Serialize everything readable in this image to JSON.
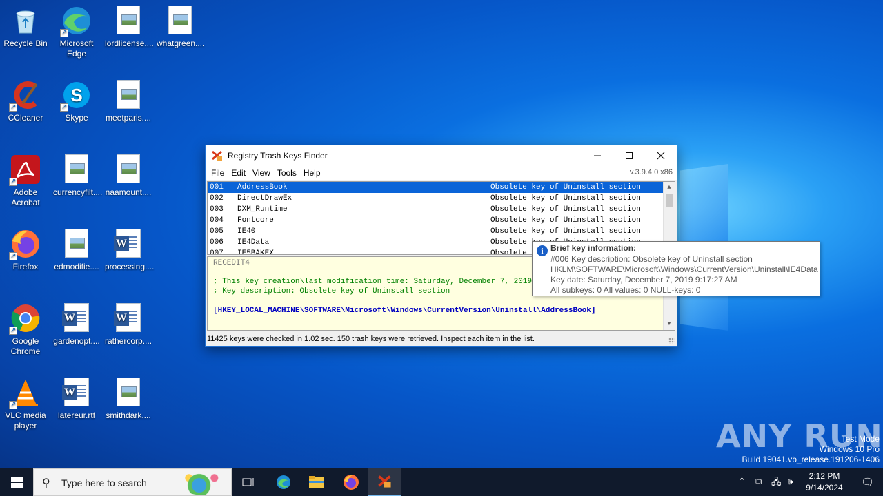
{
  "desktop": {
    "icons": [
      {
        "label": "Recycle Bin",
        "type": "recycle"
      },
      {
        "label": "Microsoft Edge",
        "type": "edge"
      },
      {
        "label": "lordlicense....",
        "type": "file"
      },
      {
        "label": "whatgreen....",
        "type": "file"
      },
      {
        "label": "CCleaner",
        "type": "ccleaner"
      },
      {
        "label": "Skype",
        "type": "skype"
      },
      {
        "label": "meetparis....",
        "type": "file"
      },
      {
        "label": "Adobe Acrobat",
        "type": "acrobat"
      },
      {
        "label": "currencyfilt....",
        "type": "file"
      },
      {
        "label": "naamount....",
        "type": "file"
      },
      {
        "label": "Firefox",
        "type": "firefox"
      },
      {
        "label": "edmodifie....",
        "type": "file"
      },
      {
        "label": "processing....",
        "type": "word"
      },
      {
        "label": "Google Chrome",
        "type": "chrome"
      },
      {
        "label": "gardenopt....",
        "type": "word"
      },
      {
        "label": "rathercorp....",
        "type": "word"
      },
      {
        "label": "VLC media player",
        "type": "vlc"
      },
      {
        "label": "latereur.rtf",
        "type": "word"
      },
      {
        "label": "smithdark....",
        "type": "file"
      }
    ]
  },
  "window": {
    "title": "Registry Trash Keys Finder",
    "version": "v.3.9.4.0 x86",
    "menu": [
      "File",
      "Edit",
      "View",
      "Tools",
      "Help"
    ],
    "rows": [
      {
        "num": "001",
        "name": "AddressBook",
        "desc": "Obsolete key of Uninstall section",
        "selected": true
      },
      {
        "num": "002",
        "name": "DirectDrawEx",
        "desc": "Obsolete key of Uninstall section",
        "selected": false
      },
      {
        "num": "003",
        "name": "DXM_Runtime",
        "desc": "Obsolete key of Uninstall section",
        "selected": false
      },
      {
        "num": "004",
        "name": "Fontcore",
        "desc": "Obsolete key of Uninstall section",
        "selected": false
      },
      {
        "num": "005",
        "name": "IE40",
        "desc": "Obsolete key of Uninstall section",
        "selected": false
      },
      {
        "num": "006",
        "name": "IE4Data",
        "desc": "Obsolete key of Uninstall section",
        "selected": false
      },
      {
        "num": "007",
        "name": "IE5BAKEX",
        "desc": "Obsolete key of Uninstall section",
        "selected": false
      }
    ],
    "reg": {
      "header": "REGEDIT4",
      "comment1": "; This key creation\\last modification time: Saturday, December 7, 2019 9:17:27 AM",
      "comment2": "; Key description: Obsolete key of Uninstall section",
      "key": "[HKEY_LOCAL_MACHINE\\SOFTWARE\\Microsoft\\Windows\\CurrentVersion\\Uninstall\\AddressBook]"
    },
    "status": "11425 keys were checked in 1.02 sec. 150 trash keys were retrieved. Inspect each item in the list."
  },
  "tooltip": {
    "title": "Brief key information:",
    "line1": "#006        Key description:  Obsolete key of Uninstall section",
    "line2": "HKLM\\SOFTWARE\\Microsoft\\Windows\\CurrentVersion\\Uninstall\\IE4Data",
    "line3": "Key date: Saturday, December 7, 2019 9:17:27 AM",
    "line4": "All subkeys: 0    All values: 0    NULL-keys: 0"
  },
  "watermark": {
    "brand": "ANY RUN",
    "mode": "Test Mode",
    "os": "Windows 10 Pro",
    "build": "Build 19041.vb_release.191206-1406"
  },
  "taskbar": {
    "search_placeholder": "Type here to search",
    "time": "2:12 PM",
    "date": "9/14/2024"
  }
}
